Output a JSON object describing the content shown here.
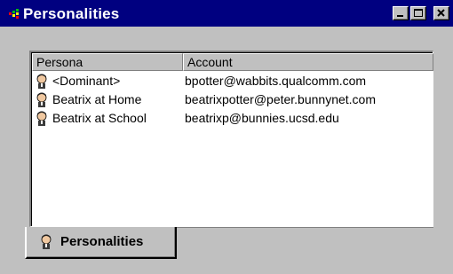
{
  "window": {
    "title": "Personalities",
    "title_icon": "personalities-app-icon",
    "buttons": {
      "minimize_icon": "minimize-icon",
      "maximize_icon": "maximize-icon",
      "close_icon": "close-icon"
    }
  },
  "list": {
    "columns": [
      "Persona",
      "Account"
    ],
    "rows": [
      {
        "persona": "<Dominant>",
        "account": "bpotter@wabbits.qualcomm.com",
        "icon": "persona-icon"
      },
      {
        "persona": "Beatrix at Home",
        "account": "beatrixpotter@peter.bunnynet.com",
        "icon": "persona-icon"
      },
      {
        "persona": "Beatrix at School",
        "account": "beatrixp@bunnies.ucsd.edu",
        "icon": "persona-icon"
      }
    ]
  },
  "tab": {
    "label": "Personalities",
    "icon": "persona-icon"
  },
  "colors": {
    "titlebar": "#000080",
    "face": "#c0c0c0",
    "list_background": "#ffffff"
  }
}
